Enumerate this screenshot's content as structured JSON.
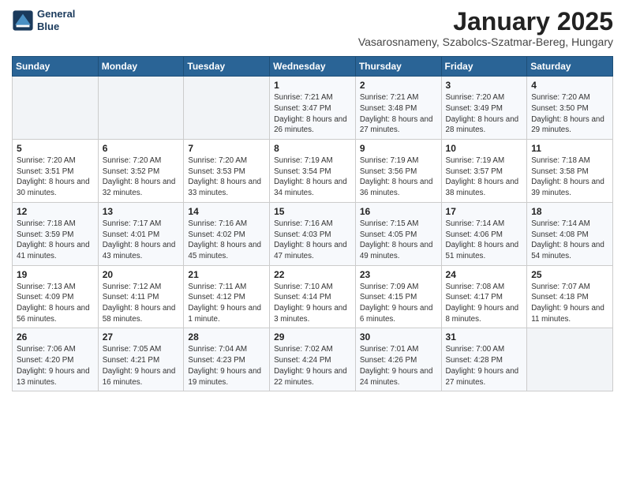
{
  "logo": {
    "line1": "General",
    "line2": "Blue"
  },
  "title": "January 2025",
  "subtitle": "Vasarosnameny, Szabolcs-Szatmar-Bereg, Hungary",
  "weekdays": [
    "Sunday",
    "Monday",
    "Tuesday",
    "Wednesday",
    "Thursday",
    "Friday",
    "Saturday"
  ],
  "weeks": [
    [
      {
        "day": "",
        "empty": true
      },
      {
        "day": "",
        "empty": true
      },
      {
        "day": "",
        "empty": true
      },
      {
        "day": "1",
        "sunrise": "7:21 AM",
        "sunset": "3:47 PM",
        "daylight": "8 hours and 26 minutes."
      },
      {
        "day": "2",
        "sunrise": "7:21 AM",
        "sunset": "3:48 PM",
        "daylight": "8 hours and 27 minutes."
      },
      {
        "day": "3",
        "sunrise": "7:20 AM",
        "sunset": "3:49 PM",
        "daylight": "8 hours and 28 minutes."
      },
      {
        "day": "4",
        "sunrise": "7:20 AM",
        "sunset": "3:50 PM",
        "daylight": "8 hours and 29 minutes."
      }
    ],
    [
      {
        "day": "5",
        "sunrise": "7:20 AM",
        "sunset": "3:51 PM",
        "daylight": "8 hours and 30 minutes."
      },
      {
        "day": "6",
        "sunrise": "7:20 AM",
        "sunset": "3:52 PM",
        "daylight": "8 hours and 32 minutes."
      },
      {
        "day": "7",
        "sunrise": "7:20 AM",
        "sunset": "3:53 PM",
        "daylight": "8 hours and 33 minutes."
      },
      {
        "day": "8",
        "sunrise": "7:19 AM",
        "sunset": "3:54 PM",
        "daylight": "8 hours and 34 minutes."
      },
      {
        "day": "9",
        "sunrise": "7:19 AM",
        "sunset": "3:56 PM",
        "daylight": "8 hours and 36 minutes."
      },
      {
        "day": "10",
        "sunrise": "7:19 AM",
        "sunset": "3:57 PM",
        "daylight": "8 hours and 38 minutes."
      },
      {
        "day": "11",
        "sunrise": "7:18 AM",
        "sunset": "3:58 PM",
        "daylight": "8 hours and 39 minutes."
      }
    ],
    [
      {
        "day": "12",
        "sunrise": "7:18 AM",
        "sunset": "3:59 PM",
        "daylight": "8 hours and 41 minutes."
      },
      {
        "day": "13",
        "sunrise": "7:17 AM",
        "sunset": "4:01 PM",
        "daylight": "8 hours and 43 minutes."
      },
      {
        "day": "14",
        "sunrise": "7:16 AM",
        "sunset": "4:02 PM",
        "daylight": "8 hours and 45 minutes."
      },
      {
        "day": "15",
        "sunrise": "7:16 AM",
        "sunset": "4:03 PM",
        "daylight": "8 hours and 47 minutes."
      },
      {
        "day": "16",
        "sunrise": "7:15 AM",
        "sunset": "4:05 PM",
        "daylight": "8 hours and 49 minutes."
      },
      {
        "day": "17",
        "sunrise": "7:14 AM",
        "sunset": "4:06 PM",
        "daylight": "8 hours and 51 minutes."
      },
      {
        "day": "18",
        "sunrise": "7:14 AM",
        "sunset": "4:08 PM",
        "daylight": "8 hours and 54 minutes."
      }
    ],
    [
      {
        "day": "19",
        "sunrise": "7:13 AM",
        "sunset": "4:09 PM",
        "daylight": "8 hours and 56 minutes."
      },
      {
        "day": "20",
        "sunrise": "7:12 AM",
        "sunset": "4:11 PM",
        "daylight": "8 hours and 58 minutes."
      },
      {
        "day": "21",
        "sunrise": "7:11 AM",
        "sunset": "4:12 PM",
        "daylight": "9 hours and 1 minute."
      },
      {
        "day": "22",
        "sunrise": "7:10 AM",
        "sunset": "4:14 PM",
        "daylight": "9 hours and 3 minutes."
      },
      {
        "day": "23",
        "sunrise": "7:09 AM",
        "sunset": "4:15 PM",
        "daylight": "9 hours and 6 minutes."
      },
      {
        "day": "24",
        "sunrise": "7:08 AM",
        "sunset": "4:17 PM",
        "daylight": "9 hours and 8 minutes."
      },
      {
        "day": "25",
        "sunrise": "7:07 AM",
        "sunset": "4:18 PM",
        "daylight": "9 hours and 11 minutes."
      }
    ],
    [
      {
        "day": "26",
        "sunrise": "7:06 AM",
        "sunset": "4:20 PM",
        "daylight": "9 hours and 13 minutes."
      },
      {
        "day": "27",
        "sunrise": "7:05 AM",
        "sunset": "4:21 PM",
        "daylight": "9 hours and 16 minutes."
      },
      {
        "day": "28",
        "sunrise": "7:04 AM",
        "sunset": "4:23 PM",
        "daylight": "9 hours and 19 minutes."
      },
      {
        "day": "29",
        "sunrise": "7:02 AM",
        "sunset": "4:24 PM",
        "daylight": "9 hours and 22 minutes."
      },
      {
        "day": "30",
        "sunrise": "7:01 AM",
        "sunset": "4:26 PM",
        "daylight": "9 hours and 24 minutes."
      },
      {
        "day": "31",
        "sunrise": "7:00 AM",
        "sunset": "4:28 PM",
        "daylight": "9 hours and 27 minutes."
      },
      {
        "day": "",
        "empty": true
      }
    ]
  ]
}
